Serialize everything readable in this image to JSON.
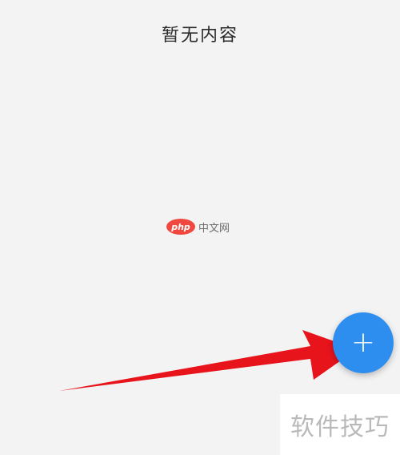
{
  "empty_state": {
    "message": "暂无内容"
  },
  "watermark": {
    "logo_text": "php",
    "site_text": "中文网"
  },
  "fab": {
    "icon": "plus-icon",
    "symbol": "+",
    "color": "#2d8ef0"
  },
  "annotation": {
    "arrow_color": "#e8141c"
  },
  "corner_watermark": {
    "text": "软件技巧"
  }
}
